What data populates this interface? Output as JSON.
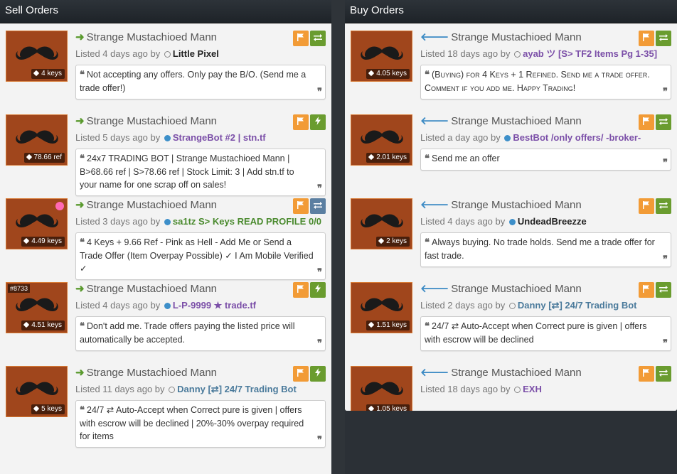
{
  "sell": {
    "heading": "Sell Orders",
    "listings": [
      {
        "title": "Strange Mustachioed Mann",
        "price": "4 keys",
        "listed": "Listed 4 days ago by",
        "user": "Little Pixel",
        "status": "offline",
        "comment": "Not accepting any offers. Only pay the B/O. (Send me a trade offer!)",
        "action": "trade"
      },
      {
        "title": "Strange Mustachioed Mann",
        "price": "78.66 ref",
        "listed": "Listed 5 days ago by",
        "user": "StrangeBot #2 | stn.tf",
        "status": "online",
        "comment": "24x7 TRADING BOT | Strange Mustachioed Mann | B>68.66 ref | S>78.66 ref | Stock Limit: 3 | Add stn.tf to your name for one scrap off on sales!",
        "action": "bolt"
      },
      {
        "title": "Strange Mustachioed Mann",
        "price": "4.49 keys",
        "listed": "Listed 3 days ago by",
        "user": "sa1tz  S> Keys READ PROFILE 0/0",
        "status": "online",
        "comment": "4 Keys + 9.66 Ref - Pink as Hell - Add Me or Send a Trade Offer (Item Overpay Possible) ✓ I Am Mobile Verified ✓",
        "action": "trade-blue",
        "paint": "#ff69b4"
      },
      {
        "title": "Strange Mustachioed Mann",
        "price": "4.51 keys",
        "serial": "#8733",
        "listed": "Listed 4 days ago by",
        "user": "L-P-9999 ★ trade.tf",
        "status": "online",
        "comment": "Don't add me. Trade offers paying the listed price will automatically be accepted.",
        "action": "bolt"
      },
      {
        "title": "Strange Mustachioed Mann",
        "price": "5 keys",
        "listed": "Listed 11 days ago by",
        "user": "Danny [⇄] 24/7 Trading Bot",
        "status": "offline",
        "comment": "24/7 ⇄ Auto-Accept when Correct pure is given | offers with escrow will be declined | 20%-30% overpay required for items",
        "action": "bolt"
      }
    ]
  },
  "buy": {
    "heading": "Buy Orders",
    "listings": [
      {
        "title": "Strange Mustachioed Mann",
        "price": "4.05 keys",
        "listed": "Listed 18 days ago by",
        "user": "ayab ツ [S> TF2 Items Pg 1-35]",
        "status": "offline",
        "comment": "(Buying) for 4 Keys + 1 Refined. Send me a trade offer. Comment if you add me. Happy Trading!",
        "action": "trade"
      },
      {
        "title": "Strange Mustachioed Mann",
        "price": "2.01 keys",
        "listed": "Listed a day ago by",
        "user": "BestBot /only offers/ -broker-",
        "status": "online",
        "comment": "Send me an offer",
        "action": "trade"
      },
      {
        "title": "Strange Mustachioed Mann",
        "price": "2 keys",
        "listed": "Listed 4 days ago by",
        "user": "UndeadBreezze",
        "status": "online",
        "comment": "Always buying. No trade holds. Send me a trade offer for fast trade.",
        "action": "trade"
      },
      {
        "title": "Strange Mustachioed Mann",
        "price": "1.51 keys",
        "listed": "Listed 2 days ago by",
        "user": "Danny [⇄] 24/7 Trading Bot",
        "status": "offline",
        "comment": "24/7 ⇄ Auto-Accept when Correct pure is given | offers with escrow will be declined",
        "action": "trade"
      },
      {
        "title": "Strange Mustachioed Mann",
        "price": "1.05 keys",
        "listed": "Listed 18 days ago by",
        "user": "EXH",
        "status": "offline",
        "comment": "",
        "action": "trade"
      }
    ]
  },
  "icons": {
    "flag": "flag-icon",
    "trade": "exchange-icon",
    "bolt": "lightning-icon",
    "tag": "price-tag-icon",
    "quote": "quote-icon"
  },
  "colors": {
    "item_bg": "#a0461c",
    "sell_arrow": "#5a9a2e",
    "buy_arrow": "#3b8ac4",
    "flag_btn": "#f29b36",
    "trade_btn": "#6a9c2f",
    "online": "#3d8fc9"
  }
}
